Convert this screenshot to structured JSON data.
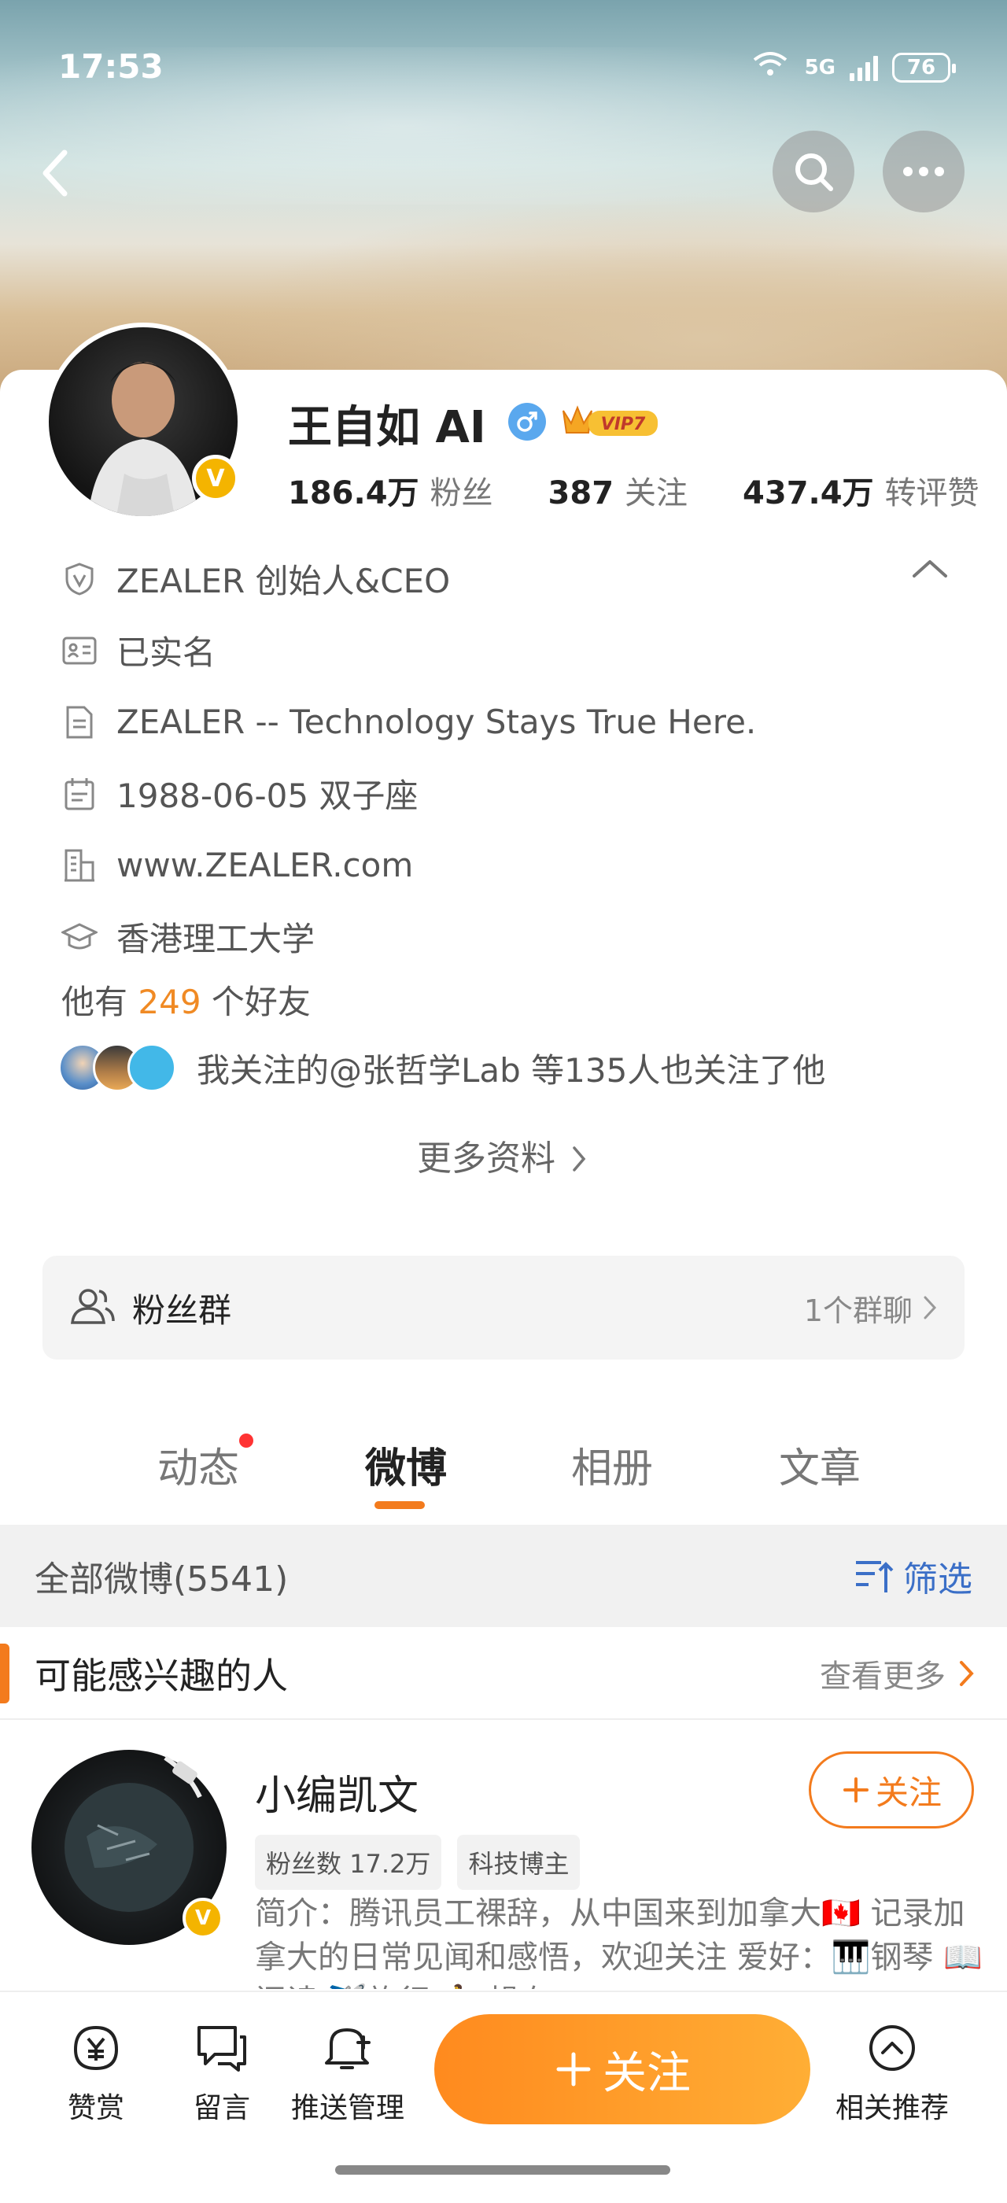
{
  "status_bar": {
    "time": "17:53",
    "wifi": "7+",
    "network": "5G",
    "battery": "76"
  },
  "profile": {
    "name": "王自如 AI",
    "vip_label": "VIP7",
    "stats": [
      {
        "value": "186.4万",
        "label": "粉丝"
      },
      {
        "value": "387",
        "label": "关注"
      },
      {
        "value": "437.4万",
        "label": "转评赞"
      }
    ],
    "info": [
      {
        "icon": "shield-v-icon",
        "text": "ZEALER 创始人&CEO"
      },
      {
        "icon": "id-card-icon",
        "text": "已实名"
      },
      {
        "icon": "document-icon",
        "text": "ZEALER -- Technology Stays True Here."
      },
      {
        "icon": "calendar-icon",
        "text": "1988-06-05 双子座"
      },
      {
        "icon": "building-icon",
        "text": "www.ZEALER.com"
      },
      {
        "icon": "graduation-cap-icon",
        "text": "香港理工大学"
      }
    ],
    "friends_prefix": "他有",
    "friends_count": "249",
    "friends_suffix": "个好友",
    "mutual_text": "我关注的@张哲学Lab 等135人也关注了他",
    "more_info": "更多资料"
  },
  "fan_group": {
    "label": "粉丝群",
    "count": "1个群聊"
  },
  "tabs": [
    {
      "label": "动态",
      "dot": true
    },
    {
      "label": "微博",
      "active": true
    },
    {
      "label": "相册"
    },
    {
      "label": "文章"
    }
  ],
  "filter_bar": {
    "all_label": "全部微博(5541)",
    "filter_label": "筛选"
  },
  "recommend": {
    "title": "可能感兴趣的人",
    "more": "查看更多",
    "item": {
      "name": "小编凯文",
      "follow_label": "关注",
      "tags": [
        "粉丝数 17.2万",
        "科技博主"
      ],
      "desc": "简介：腾讯员工裸辞，从中国来到加拿大🇨🇦 记录加拿大的日常见闻和感悟，欢迎关注 爱好：🎹钢琴 📖阅读 ✈️旅行 🏃‍♂️ 操有"
    }
  },
  "toolbar": {
    "reward": "赞赏",
    "message": "留言",
    "push": "推送管理",
    "follow": "关注",
    "related": "相关推荐"
  },
  "colors": {
    "accent": "#f37b1d",
    "link": "#3b6fc7",
    "vip_gold": "#f4b400"
  }
}
